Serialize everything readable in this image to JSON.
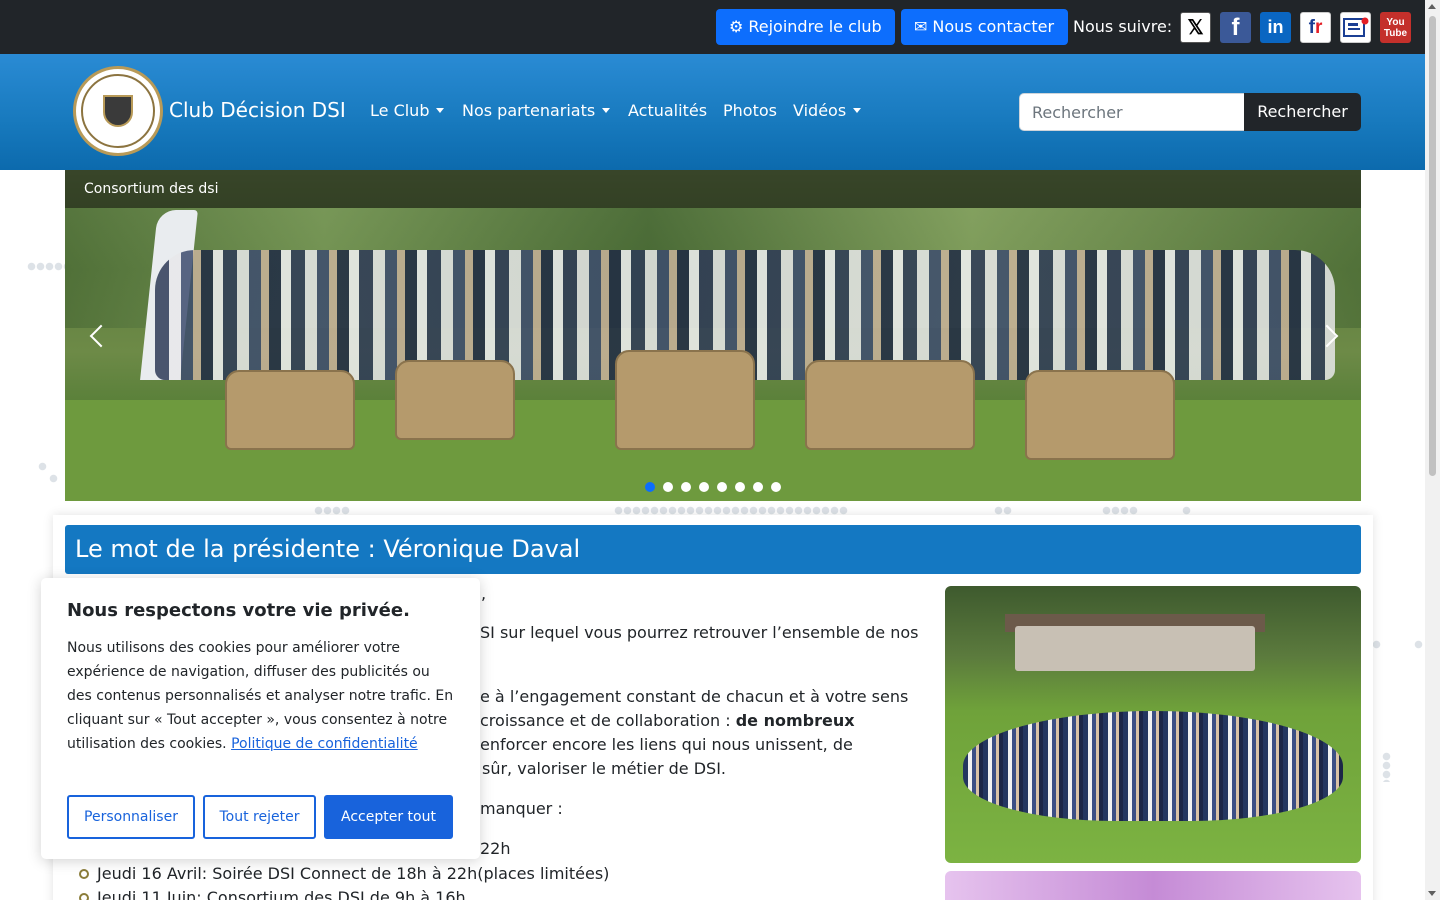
{
  "topbar": {
    "join_label": "Rejoindre le club",
    "contact_label": "Nous contacter",
    "follow_label": "Nous suivre:",
    "social_icons": [
      "x-icon",
      "facebook-icon",
      "linkedin-icon",
      "frenchweb-icon",
      "magazine-icon",
      "youtube-icon"
    ]
  },
  "nav": {
    "brand": "Club Décision DSI",
    "items": [
      {
        "label": "Le Club",
        "dropdown": true
      },
      {
        "label": "Nos partenariats",
        "dropdown": true
      },
      {
        "label": "Actualités",
        "dropdown": false
      },
      {
        "label": "Photos",
        "dropdown": false
      },
      {
        "label": "Vidéos",
        "dropdown": true
      }
    ],
    "search_placeholder": "Rechercher",
    "search_button": "Rechercher"
  },
  "carousel": {
    "caption": "Consortium des dsi",
    "slide_count": 8,
    "active_index": 0
  },
  "content": {
    "title": "Le mot de la présidente : Véronique Daval",
    "paragraph_fragments": [
      ",",
      "SI sur lequel vous pourrez retrouver l’ensemble de nos",
      "e à l’engagement constant de chacun et à votre sens",
      "croissance et de collaboration :",
      "de nombreux",
      "enforcer encore les liens qui nous unissent, de",
      "sûr, valoriser le métier de DSI.",
      "manquer :",
      "22h"
    ],
    "events": [
      "Jeudi 16 Avril: Soirée DSI Connect de 18h à 22h(places limitées)",
      "Jeudi 11 Juin: Consortium des DSI de 9h à 16h"
    ]
  },
  "cookie": {
    "title": "Nous respectons votre vie privée.",
    "text": "Nous utilisons des cookies pour améliorer votre expérience de navigation, diffuser des publicités ou des contenus personnalisés et analyser notre trafic. En cliquant sur « Tout accepter », vous consentez à notre utilisation des cookies.",
    "link": "Politique de confidentialité",
    "customize": "Personnaliser",
    "reject": "Tout rejeter",
    "accept": "Accepter tout"
  },
  "colors": {
    "topbar_bg": "#212529",
    "button_blue": "#0d6efd",
    "nav_blue": "#1779bd",
    "title_bar": "#1478c2",
    "cookie_blue": "#1863dc"
  }
}
